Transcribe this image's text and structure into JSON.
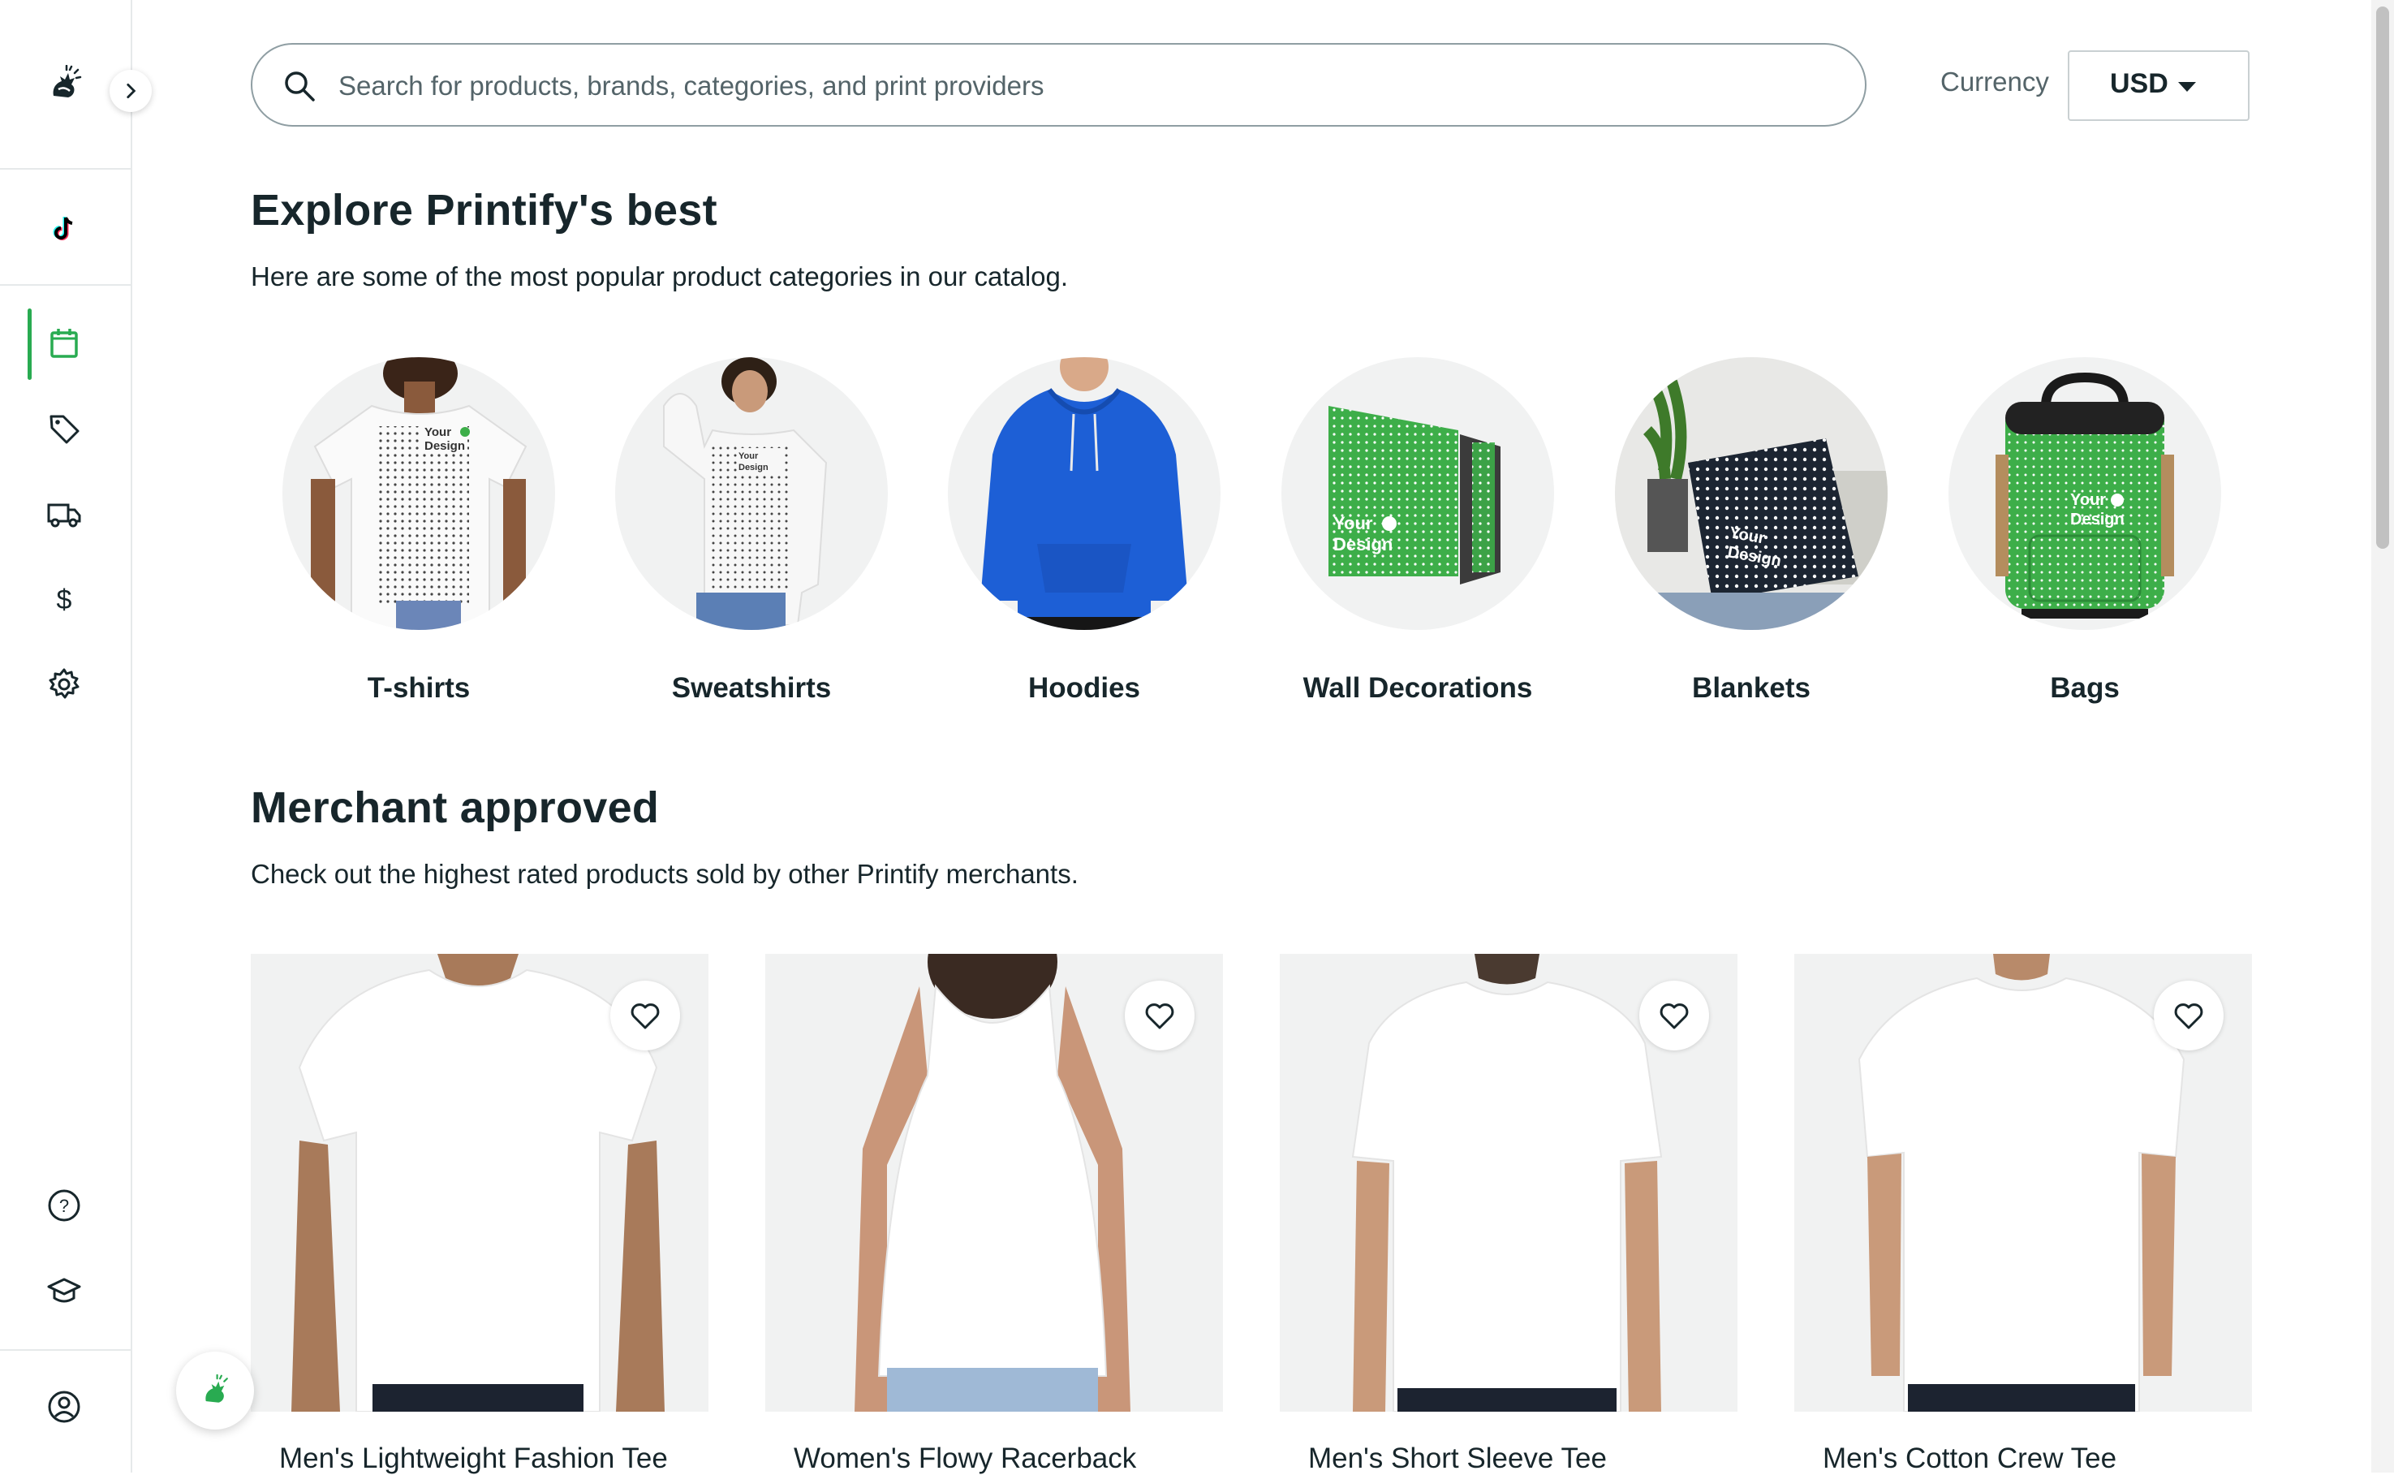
{
  "app": {
    "name": "Printify"
  },
  "search": {
    "placeholder": "Search for products, brands, categories, and print providers"
  },
  "currency": {
    "label": "Currency",
    "value": "USD"
  },
  "explore": {
    "title": "Explore Printify's best",
    "subtitle": "Here are some of the most popular product categories in our catalog.",
    "categories": [
      {
        "label": "T-shirts"
      },
      {
        "label": "Sweatshirts"
      },
      {
        "label": "Hoodies"
      },
      {
        "label": "Wall Decorations"
      },
      {
        "label": "Blankets"
      },
      {
        "label": "Bags"
      }
    ],
    "design_text_line1": "Your",
    "design_text_line2": "Design"
  },
  "merchant": {
    "title": "Merchant approved",
    "subtitle": "Check out the highest rated products sold by other Printify merchants.",
    "products": [
      {
        "title": "Men's Lightweight Fashion Tee"
      },
      {
        "title": "Women's Flowy Racerback"
      },
      {
        "title": "Men's Short Sleeve Tee"
      },
      {
        "title": "Men's Cotton Crew Tee"
      }
    ]
  },
  "sidebar": {
    "items": [
      {
        "icon": "printify-logo-icon"
      },
      {
        "icon": "expand-chevron-icon"
      },
      {
        "icon": "tiktok-icon"
      },
      {
        "icon": "catalog-icon",
        "active": true
      },
      {
        "icon": "tag-icon"
      },
      {
        "icon": "truck-icon"
      },
      {
        "icon": "dollar-icon"
      },
      {
        "icon": "gear-icon"
      },
      {
        "icon": "help-icon"
      },
      {
        "icon": "academy-icon"
      },
      {
        "icon": "account-icon"
      }
    ]
  },
  "colors": {
    "accent": "#29ab51",
    "text": "#17262b",
    "muted": "#546469",
    "tile": "#f1f2f2",
    "design_green": "#3dae49"
  }
}
